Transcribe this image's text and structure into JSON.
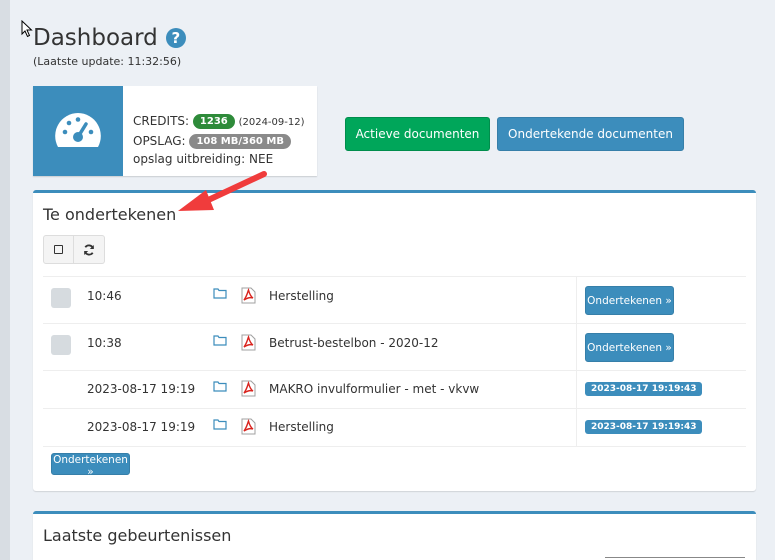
{
  "header": {
    "title": "Dashboard",
    "help_glyph": "?",
    "last_update": "(Laatste update: 11:32:56)"
  },
  "info_box": {
    "icon": "dashboard-gauge-icon",
    "credits_label": "CREDITS:",
    "credits_value": "1236",
    "credits_date": "(2024-09-12)",
    "storage_label": "OPSLAG:",
    "storage_value": "108 MB/360 MB",
    "extension_text": "opslag uitbreiding: NEE"
  },
  "top_buttons": {
    "active_docs": "Actieve documenten",
    "signing_docs": "Ondertekende documenten"
  },
  "to_sign": {
    "title": "Te ondertekenen",
    "rows": [
      {
        "time": "10:46",
        "document": "Herstelling",
        "action": "Ondertekenen »"
      },
      {
        "time": "10:38",
        "document": "Betrust-bestelbon - 2020-12",
        "action": "Ondertekenen »"
      },
      {
        "time": "2023-08-17 19:19",
        "document": "MAKRO invulformulier - met - vkvw",
        "signed_at": "2023-08-17 19:19:43"
      },
      {
        "time": "2023-08-17 19:19",
        "document": "Herstelling",
        "signed_at": "2023-08-17 19:19:43"
      }
    ],
    "bulk_action": "Ondertekenen »"
  },
  "events": {
    "title": "Laatste gebeurtenissen"
  },
  "colors": {
    "primary": "#3c8dbc",
    "success": "#00a65a",
    "annotation_arrow": "#f03c3c"
  }
}
